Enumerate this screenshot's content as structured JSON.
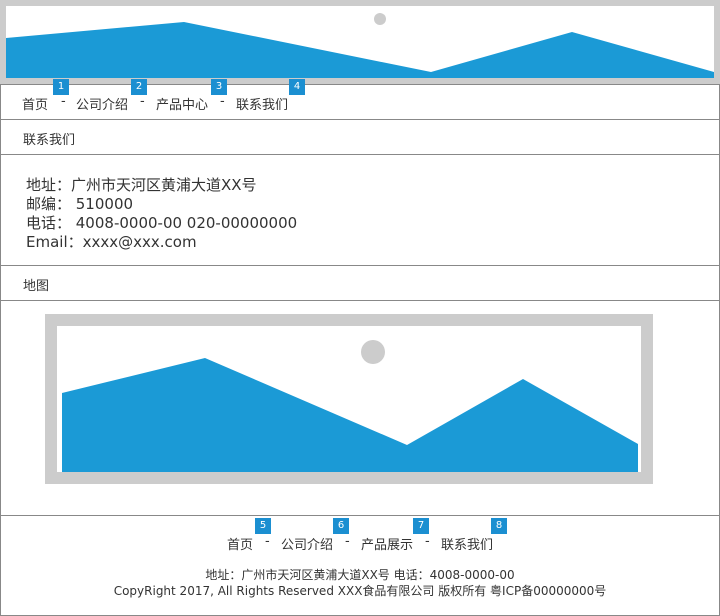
{
  "nav": {
    "items": [
      {
        "label": "首页",
        "badge": "1"
      },
      {
        "label": "公司介绍",
        "badge": "2"
      },
      {
        "label": "产品中心",
        "badge": "3"
      },
      {
        "label": "联系我们",
        "badge": "4"
      }
    ],
    "separator": "-"
  },
  "breadcrumb": {
    "current": "联系我们"
  },
  "contact": {
    "address": "地址：广州市天河区黄浦大道XX号",
    "postcode": "邮编： 510000",
    "phone": "电话： 4008-0000-00   020-00000000",
    "email": "Email：xxxx@xxx.com"
  },
  "map_section": {
    "title": "地图"
  },
  "footer": {
    "nav": [
      {
        "label": "首页",
        "badge": "5"
      },
      {
        "label": "公司介绍",
        "badge": "6"
      },
      {
        "label": "产品展示",
        "badge": "7"
      },
      {
        "label": "联系我们",
        "badge": "8"
      }
    ],
    "separator": "-",
    "info": "地址：广州市天河区黄浦大道XX号   电话：4008-0000-00",
    "copyright": "CopyRight 2017, All Rights Reserved    XXX食品有限公司 版权所有 粤ICP备00000000号"
  },
  "colors": {
    "accent": "#1b9ad6",
    "placeholder_frame": "#cccccc",
    "badge": "#1b8fd1",
    "border": "#888888"
  },
  "icons": {
    "banner": "image-placeholder-icon",
    "map": "map-image-placeholder-icon"
  }
}
